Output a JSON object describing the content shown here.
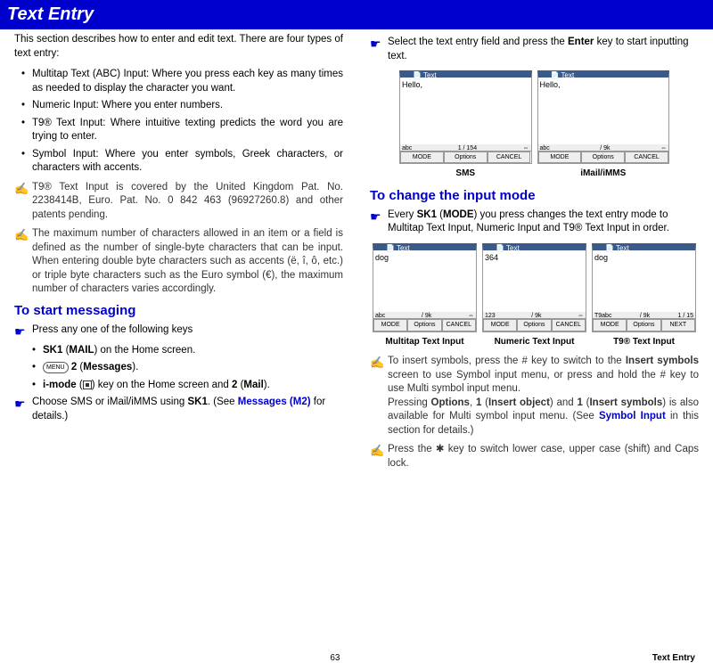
{
  "header": "Text Entry",
  "intro": "This section describes how to enter and edit text. There are four types of text entry:",
  "bullets": [
    "Multitap Text (ABC) Input: Where you press each key as many times as needed to display the character you want.",
    "Numeric Input: Where you enter numbers.",
    "T9® Text Input: Where intuitive texting predicts the word you are trying to enter.",
    "Symbol Input: Where you enter symbols, Greek characters, or characters with accents."
  ],
  "notes": [
    "T9® Text Input is covered by the United Kingdom Pat. No. 2238414B, Euro. Pat. No. 0 842 463 (96927260.8) and other patents pending.",
    "The maximum number of characters allowed in an item or a field is defined as the number of single-byte characters that can be input. When entering double byte characters such as accents (ë, î, ô, etc.) or triple byte characters such as the Euro symbol (€), the maximum number of characters varies accordingly."
  ],
  "section1_heading": "To start messaging",
  "step1": "Press any one of the following keys",
  "sub1_prefix": "SK1",
  "sub1_mid": " (",
  "sub1_bold": "MAIL",
  "sub1_suffix": ") on the Home screen.",
  "sub2_bold": "2",
  "sub2_paren": " (",
  "sub2_bold2": "Messages",
  "sub2_suffix": ").",
  "sub3_prefix": "i-mode",
  "sub3_mid": " (",
  "sub3_suffix": ") key on the Home screen and ",
  "sub3_bold": "2",
  "sub3_paren2": " (",
  "sub3_bold2": "Mail",
  "sub3_end": ").",
  "step2_prefix": "Choose SMS or iMail/iMMS using ",
  "step2_bold": "SK1",
  "step2_mid": ". (See ",
  "step2_link": "Messages (M2)",
  "step2_suffix": " for details.)",
  "right_step_prefix": "Select the text entry field and press the ",
  "right_step_bold": "Enter",
  "right_step_suffix": " key to start inputting text.",
  "sms_label": "SMS",
  "imail_label": "iMail/iMMS",
  "section2_heading": "To change the input mode",
  "change_step_prefix": "Every ",
  "change_step_sk1": "SK1",
  "change_step_paren": " (",
  "change_step_mode": "MODE",
  "change_step_suffix": ") you press changes the text entry mode to Multitap Text Input, Numeric Input and T9® Text Input in order.",
  "shot_labels": [
    "Multitap Text Input",
    "Numeric Text Input",
    "T9® Text Input"
  ],
  "phone": {
    "title": "Text",
    "hello": "Hello,",
    "dog": "dog",
    "num": "364",
    "status_abc": "abc",
    "status_123": "123",
    "status_t9": "T9abc",
    "count1": "1 / 154",
    "count2": "/ 9k",
    "count3": "1 / 15",
    "mode_btn": "MODE",
    "options_btn": "Options",
    "cancel_btn": "CANCEL",
    "next_btn": "NEXT"
  },
  "rnote1_prefix": "To insert symbols, press the # key to switch to the ",
  "rnote1_bold1": "Insert symbols",
  "rnote1_mid1": " screen to use Symbol input menu, or press and hold the # key to use Multi symbol input menu.",
  "rnote1_line2_prefix": "Pressing ",
  "rnote1_options": "Options",
  "rnote1_comma1": ", ",
  "rnote1_one1": "1",
  "rnote1_paren1": " (",
  "rnote1_insobj": "Insert object",
  "rnote1_and": ") and ",
  "rnote1_one2": "1",
  "rnote1_paren2": " (",
  "rnote1_inssym": "Insert symbols",
  "rnote1_mid2": ") is also available for Multi symbol input menu. (See ",
  "rnote1_link": "Symbol Input",
  "rnote1_suffix": " in this section for details.)",
  "rnote2": "Press the ✱ key to switch lower case, upper case (shift) and Caps lock.",
  "footer_page": "63",
  "footer_section": "Text Entry"
}
